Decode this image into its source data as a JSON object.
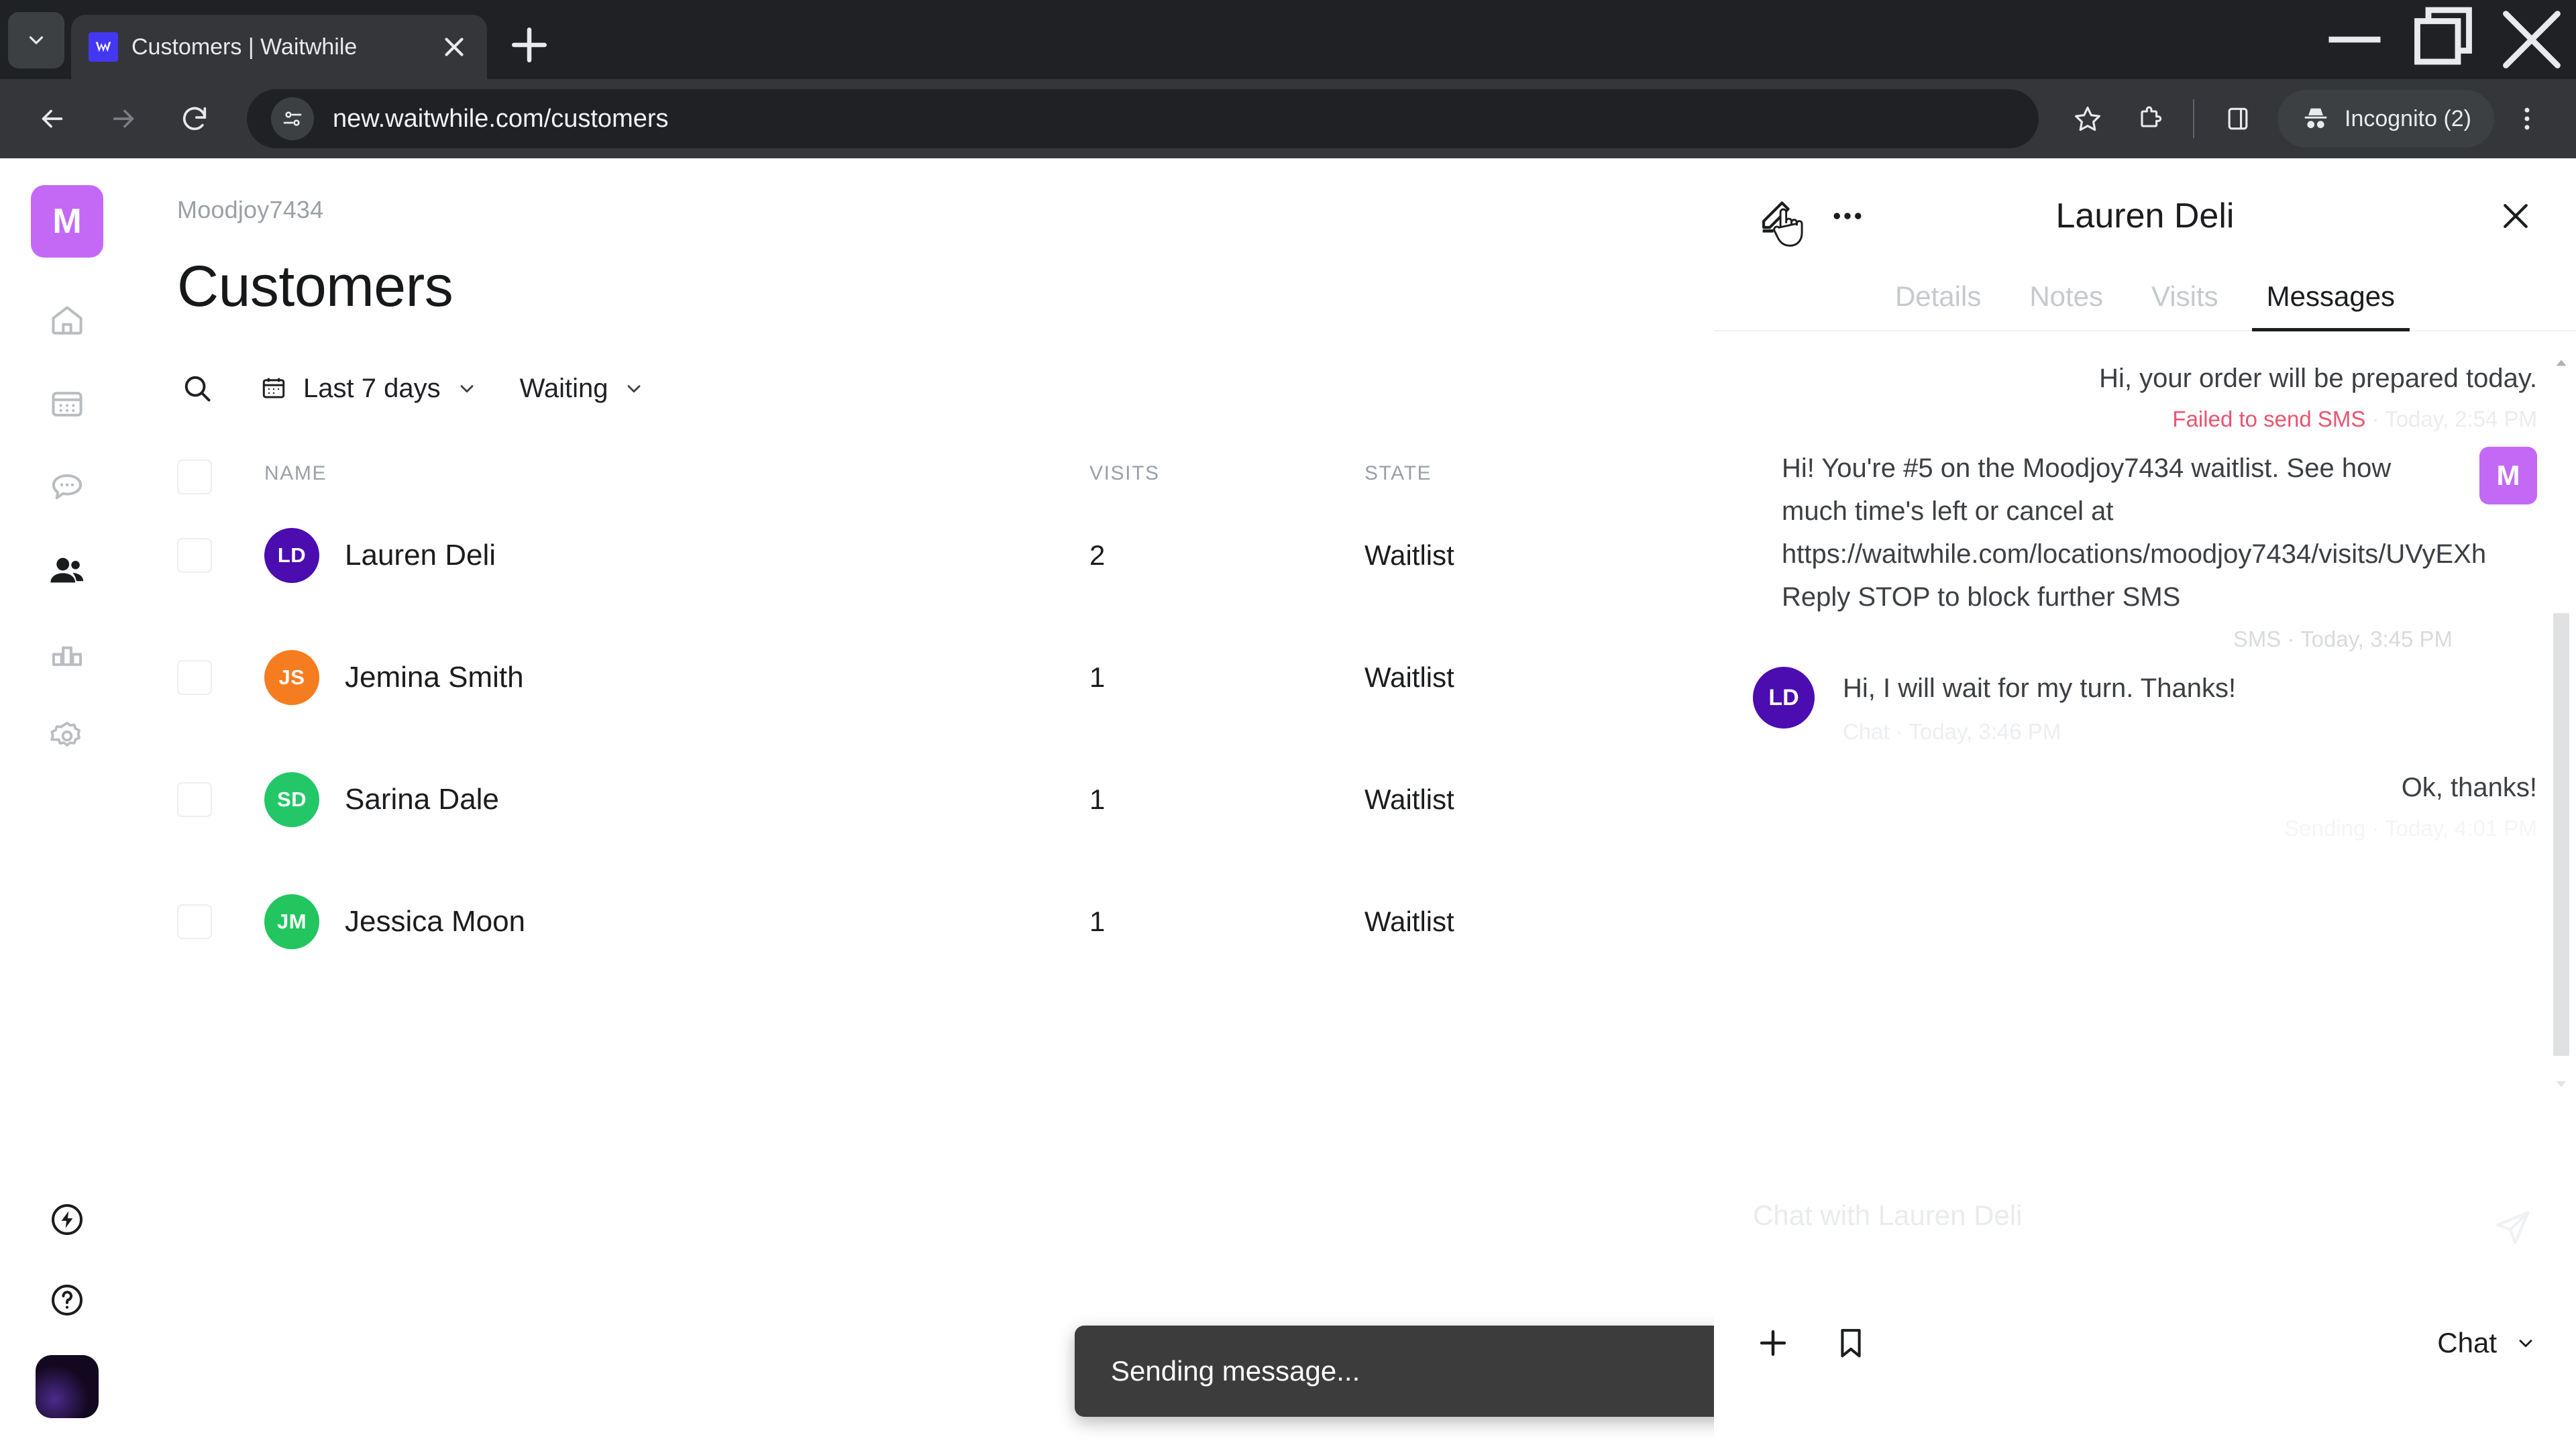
{
  "browser": {
    "tab": {
      "title": "Customers | Waitwhile",
      "favicon": "waitwhile-logo-icon",
      "close_label": "✕"
    },
    "newtab_label": "+",
    "window": {
      "minimize": "—",
      "maximize": "❐",
      "close": "✕"
    },
    "url": "new.waitwhile.com/customers",
    "profile_label": "Incognito (2)",
    "icons": {
      "tab_search": "chevron-down-icon",
      "back": "back-arrow-icon",
      "forward": "forward-arrow-icon",
      "reload": "reload-icon",
      "site_settings": "site-settings-icon",
      "bookmark": "star-icon",
      "extensions": "extensions-puzzle-icon",
      "side_panel": "side-panel-icon",
      "incognito": "incognito-hat-icon",
      "menu": "three-dot-menu-icon"
    }
  },
  "rail": {
    "brand_initial": "M",
    "items": [
      {
        "name": "home",
        "active": false
      },
      {
        "name": "calendar",
        "active": false
      },
      {
        "name": "messages",
        "active": false
      },
      {
        "name": "customers",
        "active": true
      },
      {
        "name": "analytics",
        "active": false
      },
      {
        "name": "settings",
        "active": false
      }
    ],
    "bottom": [
      {
        "name": "whats-new",
        "active": false
      },
      {
        "name": "help",
        "active": false
      }
    ],
    "avatar": "user-avatar"
  },
  "main": {
    "breadcrumb": "Moodjoy7434",
    "title": "Customers",
    "filters": {
      "search_icon": "search-icon",
      "date_range": "Last 7 days",
      "status": "Waiting"
    },
    "table": {
      "columns": [
        "NAME",
        "VISITS",
        "STATE"
      ],
      "rows": [
        {
          "initials": "LD",
          "color": "#4b0cb0",
          "name": "Lauren Deli",
          "visits": "2",
          "state": "Waitlist"
        },
        {
          "initials": "JS",
          "color": "#f57c1f",
          "name": "Jemina Smith",
          "visits": "1",
          "state": "Waitlist"
        },
        {
          "initials": "SD",
          "color": "#23c768",
          "name": "Sarina Dale",
          "visits": "1",
          "state": "Waitlist"
        },
        {
          "initials": "JM",
          "color": "#22c55e",
          "name": "Jessica Moon",
          "visits": "1",
          "state": "Waitlist"
        }
      ]
    },
    "toast": "Sending message..."
  },
  "panel": {
    "title": "Lauren Deli",
    "edit_icon": "pencil-edit-icon",
    "more_icon": "three-dot-more-icon",
    "close_icon": "close-x-icon",
    "cursor": "hand-pointer-cursor",
    "tabs": [
      {
        "label": "Details",
        "active": false
      },
      {
        "label": "Notes",
        "active": false
      },
      {
        "label": "Visits",
        "active": false
      },
      {
        "label": "Messages",
        "active": true
      }
    ],
    "messages": [
      {
        "direction": "out",
        "text": "Hi, your order will be prepared today.",
        "status": "Failed to send SMS",
        "separator": "·",
        "time": "Today, 2:54 PM",
        "failed": true
      },
      {
        "direction": "out",
        "text": "Hi! You're #5 on the Moodjoy7434 waitlist. See how much time's left or cancel at https://waitwhile.com/locations/moodjoy7434/visits/UVyEXh\nReply STOP to block further SMS",
        "status": "SMS",
        "separator": "·",
        "time": "Today, 3:45 PM",
        "avatar": "M",
        "failed": false
      },
      {
        "direction": "in",
        "text": "Hi, I will wait for my turn. Thanks!",
        "status": "Chat",
        "separator": "·",
        "time": "Today, 3:46 PM",
        "avatar": "LD",
        "failed": false
      },
      {
        "direction": "out",
        "text": "Ok, thanks!",
        "status": "Sending",
        "separator": "·",
        "time": "Today, 4:01 PM",
        "failed": false
      }
    ],
    "composer": {
      "placeholder": "Chat with Lauren Deli",
      "value": "",
      "send_icon": "send-paper-plane-icon",
      "add_icon": "plus-icon",
      "template_icon": "bookmark-icon",
      "mode": "Chat"
    }
  },
  "colors": {
    "brand_purple": "#c469f6",
    "deep_purple": "#4b0cb0",
    "error_red": "#e8546f",
    "toast_bg": "#3c3c3c"
  }
}
